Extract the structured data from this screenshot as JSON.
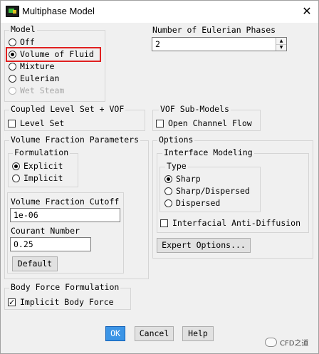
{
  "window": {
    "title": "Multiphase Model",
    "close_glyph": "✕"
  },
  "model": {
    "legend": "Model",
    "options": [
      {
        "label": "Off",
        "selected": false,
        "enabled": true
      },
      {
        "label": "Volume of Fluid",
        "selected": true,
        "enabled": true
      },
      {
        "label": "Mixture",
        "selected": false,
        "enabled": true
      },
      {
        "label": "Eulerian",
        "selected": false,
        "enabled": true
      },
      {
        "label": "Wet Steam",
        "selected": false,
        "enabled": false
      }
    ]
  },
  "phases": {
    "label": "Number of Eulerian Phases",
    "value": "2",
    "up_glyph": "▲",
    "down_glyph": "▼"
  },
  "coupled": {
    "legend": "Coupled Level Set + VOF",
    "checkbox_label": "Level Set",
    "checked": false
  },
  "vof_sub": {
    "legend": "VOF Sub-Models",
    "checkbox_label": "Open Channel Flow",
    "checked": false
  },
  "vfp": {
    "legend": "Volume Fraction Parameters",
    "formulation": {
      "legend": "Formulation",
      "options": [
        {
          "label": "Explicit",
          "selected": true
        },
        {
          "label": "Implicit",
          "selected": false
        }
      ]
    },
    "cutoff": {
      "label": "Volume Fraction Cutoff",
      "value": "1e-06"
    },
    "courant": {
      "label": "Courant Number",
      "value": "0.25"
    },
    "default_button": "Default"
  },
  "options_panel": {
    "legend": "Options",
    "interface": {
      "legend": "Interface Modeling",
      "type": {
        "legend": "Type",
        "options": [
          {
            "label": "Sharp",
            "selected": true
          },
          {
            "label": "Sharp/Dispersed",
            "selected": false
          },
          {
            "label": "Dispersed",
            "selected": false
          }
        ]
      },
      "anti_diffusion_label": "Interfacial Anti-Diffusion",
      "anti_diffusion_checked": false
    },
    "expert_button": "Expert Options..."
  },
  "body_force": {
    "legend": "Body Force Formulation",
    "checkbox_label": "Implicit Body Force",
    "checked": true,
    "check_glyph": "✓"
  },
  "footer": {
    "ok": "OK",
    "cancel": "Cancel",
    "help": "Help"
  },
  "watermark": {
    "text": "CFD之道"
  },
  "colors": {
    "highlight": "#e02020",
    "ok_button": "#3c95e6"
  }
}
